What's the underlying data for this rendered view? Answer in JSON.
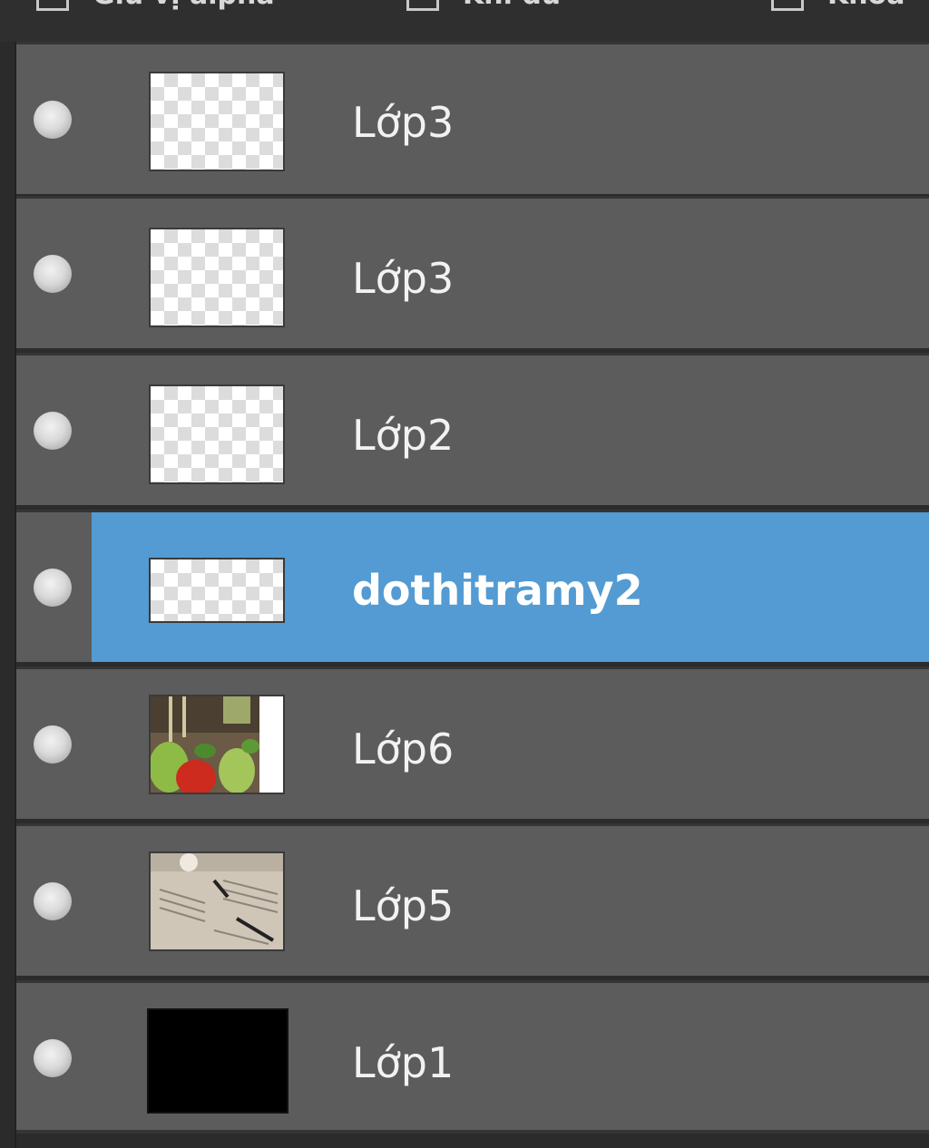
{
  "top_options": [
    {
      "label": "Giữ vị alpha"
    },
    {
      "label": "Khi đủ"
    },
    {
      "label": "Khóa"
    }
  ],
  "layers": [
    {
      "name": "Lớp3",
      "selected": false,
      "thumbnail": "transparent"
    },
    {
      "name": "Lớp3",
      "selected": false,
      "thumbnail": "transparent"
    },
    {
      "name": "Lớp2",
      "selected": false,
      "thumbnail": "transparent"
    },
    {
      "name": "dothitramy2",
      "selected": true,
      "thumbnail": "transparent-wide"
    },
    {
      "name": "Lớp6",
      "selected": false,
      "thumbnail": "strawberry-photo"
    },
    {
      "name": "Lớp5",
      "selected": false,
      "thumbnail": "newspaper-photo"
    },
    {
      "name": "Lớp1",
      "selected": false,
      "thumbnail": "black-fill"
    }
  ],
  "colors": {
    "row_bg": "#5c5c5c",
    "selected_bg": "#539bd2",
    "panel_bg": "#2b2b2b"
  }
}
